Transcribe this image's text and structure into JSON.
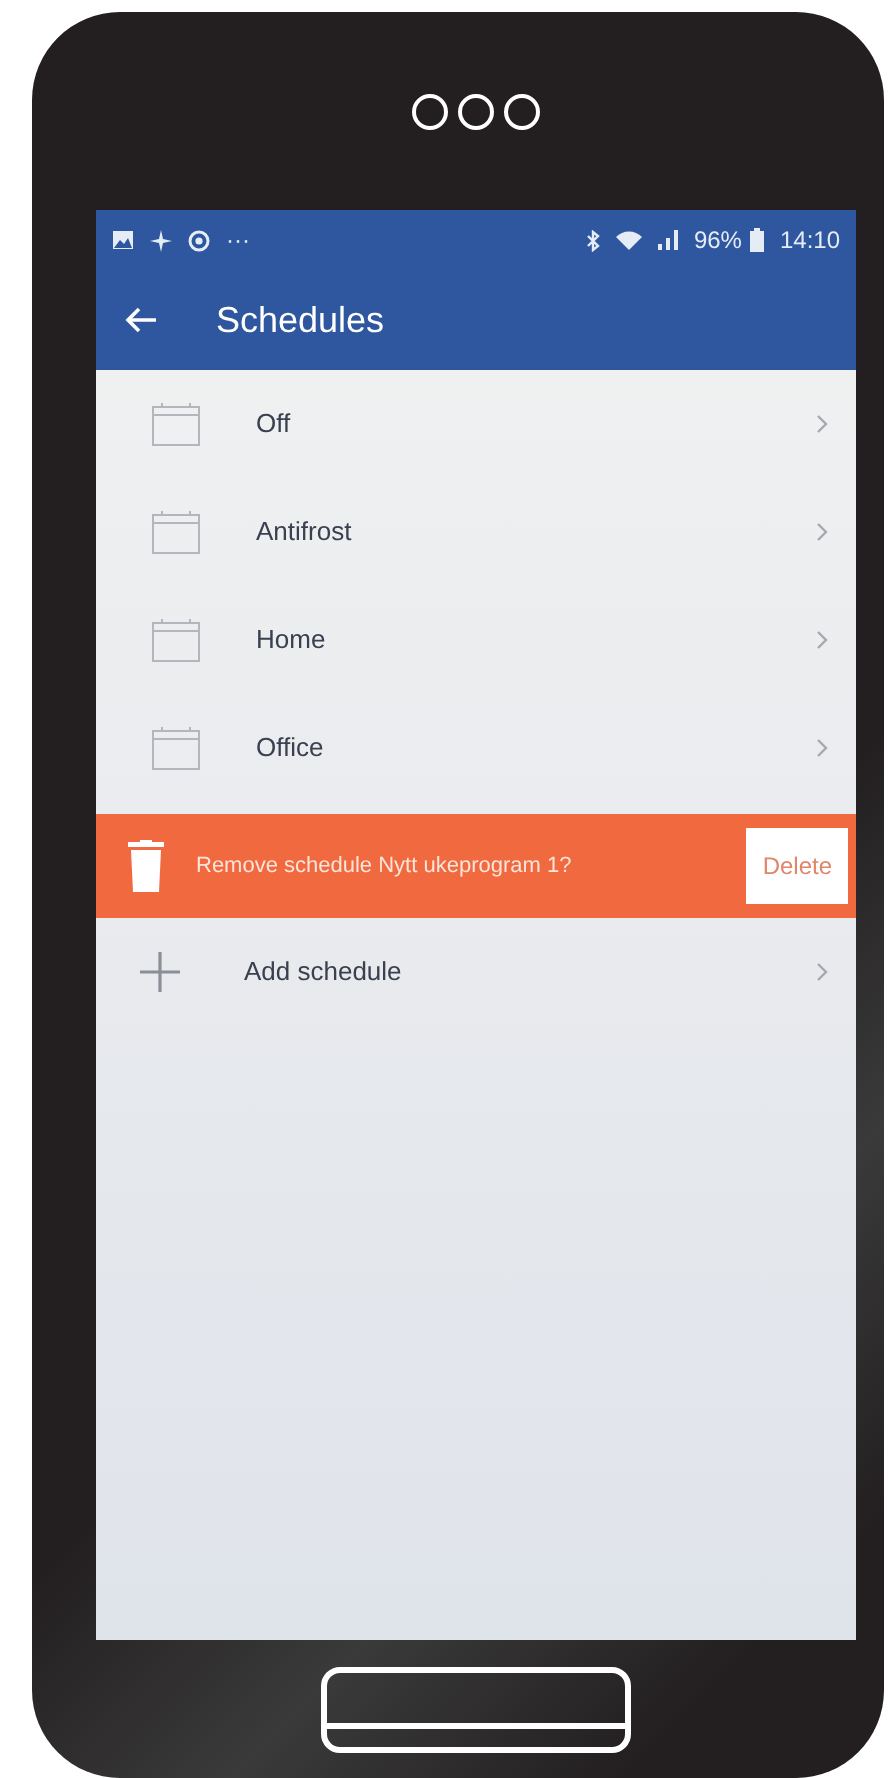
{
  "status_bar": {
    "overflow": "···",
    "battery": "96%",
    "time": "14:10"
  },
  "app_bar": {
    "title": "Schedules"
  },
  "schedules": [
    {
      "name": "Off"
    },
    {
      "name": "Antifrost"
    },
    {
      "name": "Home"
    },
    {
      "name": "Office"
    }
  ],
  "delete_prompt": {
    "message": "Remove schedule Nytt ukeprogram 1?",
    "button": "Delete"
  },
  "add_item": {
    "label": "Add schedule"
  }
}
